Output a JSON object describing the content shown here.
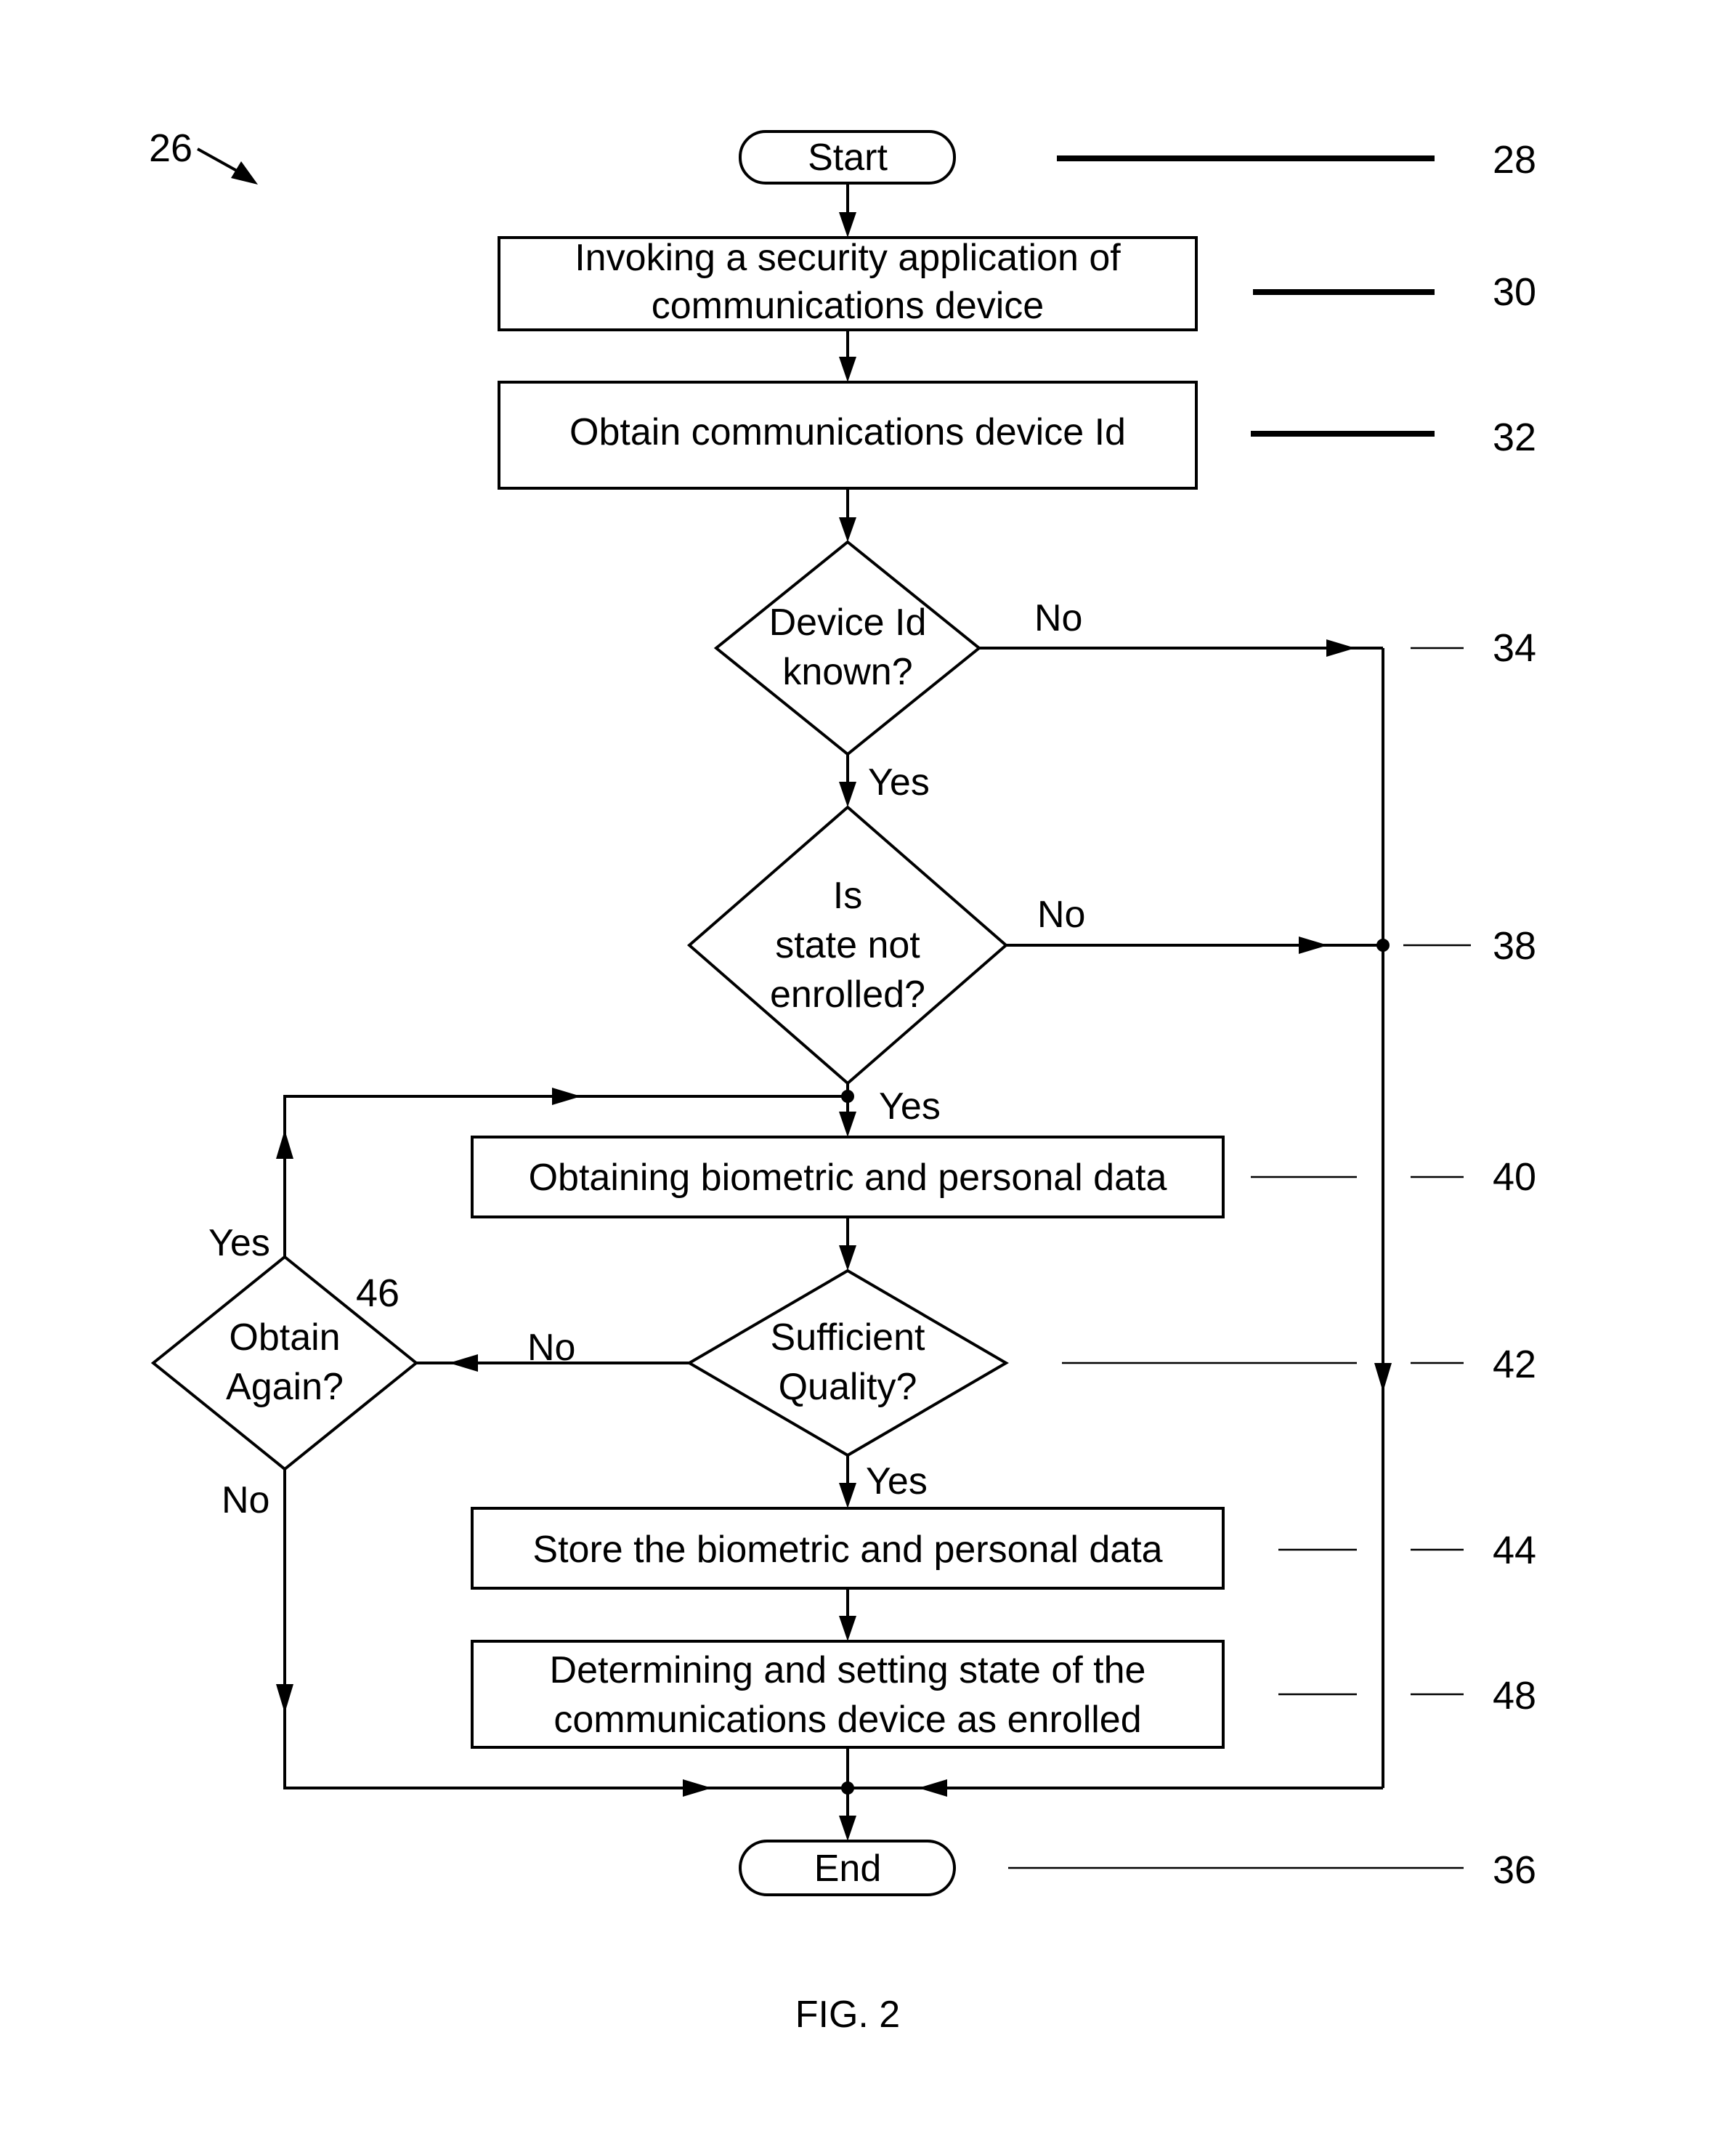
{
  "figure": {
    "label": "FIG. 2",
    "reference": "26"
  },
  "nodes": {
    "start": {
      "text": "Start",
      "ref": "28"
    },
    "invoke": {
      "lines": [
        "Invoking a security application of",
        "communications device"
      ],
      "ref": "30"
    },
    "obtain_id": {
      "text": "Obtain communications device Id",
      "ref": "32"
    },
    "device_known": {
      "lines": [
        "Device Id",
        "known?"
      ],
      "ref": "34"
    },
    "not_enrolled": {
      "lines": [
        "Is",
        "state not",
        "enrolled?"
      ],
      "ref": "38"
    },
    "obtain_data": {
      "text": "Obtaining biometric and personal data",
      "ref": "40"
    },
    "quality": {
      "lines": [
        "Sufficient",
        "Quality?"
      ],
      "ref": "42"
    },
    "obtain_again": {
      "lines": [
        "Obtain",
        "Again?"
      ],
      "ref": "46"
    },
    "store": {
      "text": "Store the biometric and personal data",
      "ref": "44"
    },
    "set_state": {
      "lines": [
        "Determining and setting state of the",
        "communications device as enrolled"
      ],
      "ref": "48"
    },
    "end": {
      "text": "End",
      "ref": "36"
    }
  },
  "edge_labels": {
    "device_known_no": "No",
    "device_known_yes": "Yes",
    "not_enrolled_no": "No",
    "not_enrolled_yes": "Yes",
    "quality_no": "No",
    "quality_yes": "Yes",
    "obtain_again_yes": "Yes",
    "obtain_again_no": "No"
  }
}
